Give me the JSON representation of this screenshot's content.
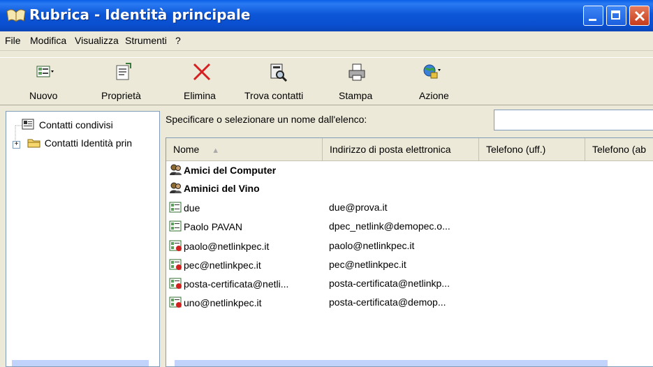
{
  "window": {
    "title": "Rubrica - Identità principale"
  },
  "menu": [
    "File",
    "Modifica",
    "Visualizza",
    "Strumenti",
    "?"
  ],
  "toolbar": {
    "new_label": "Nuovo",
    "properties_label": "Proprietà",
    "delete_label": "Elimina",
    "find_label": "Trova contatti",
    "print_label": "Stampa",
    "action_label": "Azione"
  },
  "tree": {
    "items": [
      {
        "label": "Contatti condivisi",
        "icon": "address-book-icon"
      },
      {
        "label": "Contatti Identità prin",
        "icon": "folder-icon",
        "expander": "+"
      }
    ]
  },
  "search": {
    "label": "Specificare o selezionare un nome dall'elenco:",
    "value": ""
  },
  "list": {
    "columns": [
      "Nome",
      "Indirizzo di posta elettronica",
      "Telefono (uff.)",
      "Telefono (ab"
    ],
    "rows": [
      {
        "name": "Amici del Computer",
        "email": "",
        "kind": "group"
      },
      {
        "name": "Aminici del Vino",
        "email": "",
        "kind": "group"
      },
      {
        "name": "due",
        "email": "due@prova.it",
        "kind": "contact"
      },
      {
        "name": "Paolo PAVAN",
        "email": "dpec_netlink@demopec.o...",
        "kind": "contact"
      },
      {
        "name": "paolo@netlinkpec.it",
        "email": "paolo@netlinkpec.it",
        "kind": "cert"
      },
      {
        "name": "pec@netlinkpec.it",
        "email": "pec@netlinkpec.it",
        "kind": "cert"
      },
      {
        "name": "posta-certificata@netli...",
        "email": "posta-certificata@netlinkp...",
        "kind": "cert"
      },
      {
        "name": "uno@netlinkpec.it",
        "email": "posta-certificata@demop...",
        "kind": "cert"
      }
    ]
  },
  "colors": {
    "titlebar": "#0a4fcf",
    "window_bg": "#ece9d8",
    "border": "#7f9db9"
  }
}
